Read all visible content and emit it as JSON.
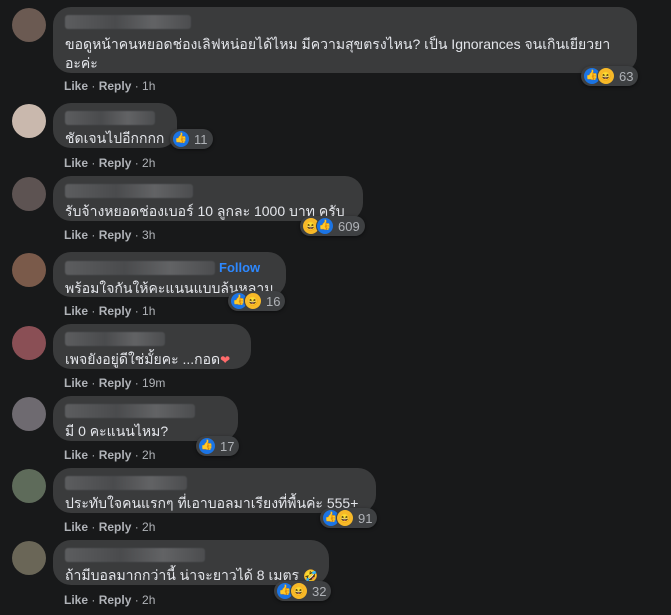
{
  "comments": [
    {
      "text": "ขอดูหน้าคนหยอดช่องเลิฟหน่อยได้ไหม มีความสุขตรงไหน? เป็น Ignorances จนเกินเยียวยาอะค่ะ",
      "reactions": [
        "like",
        "haha"
      ],
      "count": "63",
      "like_label": "Like",
      "reply_label": "Reply",
      "time": "1h",
      "avatar_color": "#6b5a52"
    },
    {
      "text": "ชัดเจนไปอีกกกก",
      "reactions": [
        "like"
      ],
      "count": "11",
      "like_label": "Like",
      "reply_label": "Reply",
      "time": "2h",
      "avatar_color": "#c9b8ad"
    },
    {
      "text": "รับจ้างหยอดช่องเบอร์ 10 ลูกละ 1000 บาท ครับ",
      "reactions": [
        "haha",
        "like"
      ],
      "count": "609",
      "like_label": "Like",
      "reply_label": "Reply",
      "time": "3h",
      "avatar_color": "#5d5352"
    },
    {
      "text": "พร้อมใจกันให้คะแนนแบบล้นหลาม",
      "follow": "Follow",
      "reactions": [
        "like",
        "haha"
      ],
      "count": "16",
      "like_label": "Like",
      "reply_label": "Reply",
      "time": "1h",
      "avatar_color": "#7a5a4a"
    },
    {
      "text": "เพจยังอยู่ดีใช่มั้ยคะ ...กอด",
      "text_emoji": "❤",
      "reactions": [],
      "count": "",
      "like_label": "Like",
      "reply_label": "Reply",
      "time": "19m",
      "avatar_color": "#8a4f55"
    },
    {
      "text": "มี 0 คะแนนไหม?",
      "reactions": [
        "like"
      ],
      "count": "17",
      "like_label": "Like",
      "reply_label": "Reply",
      "time": "2h",
      "avatar_color": "#6e6a70"
    },
    {
      "text": "ประทับใจคนแรกๆ ที่เอาบอลมาเรียงที่พื้นค่ะ 555+",
      "reactions": [
        "like",
        "haha"
      ],
      "count": "91",
      "like_label": "Like",
      "reply_label": "Reply",
      "time": "2h",
      "avatar_color": "#5e6b5a"
    },
    {
      "text": "ถ้ามีบอลมากกว่านี้ น่าจะยาวได้ 8 เมตร",
      "text_emoji": "🤣",
      "reactions": [
        "like",
        "haha"
      ],
      "count": "32",
      "like_label": "Like",
      "reply_label": "Reply",
      "time": "2h",
      "avatar_color": "#6a6657"
    }
  ],
  "icons": {
    "like": "thumbs-up-icon",
    "haha": "laughing-face-icon",
    "love": "heart-icon"
  }
}
